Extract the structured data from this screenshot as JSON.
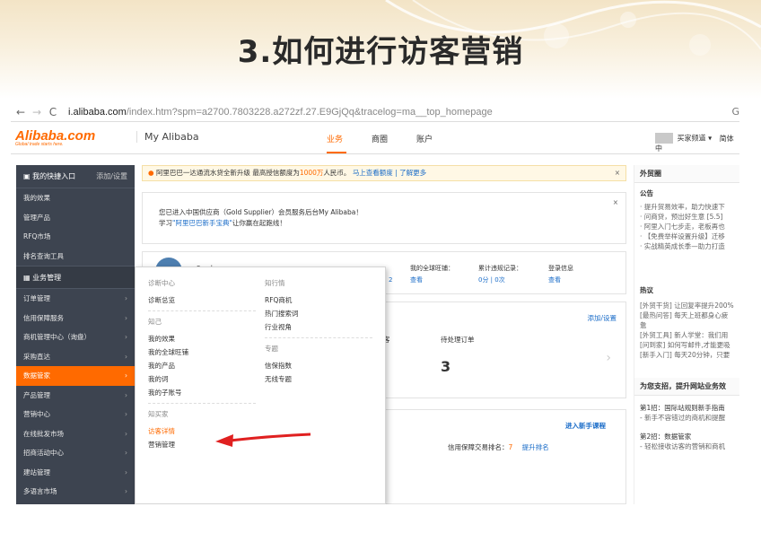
{
  "slide": {
    "title": "3.如何进行访客营销"
  },
  "browser": {
    "back": "←",
    "forward": "→",
    "reload": "C",
    "url_host": "i.alibaba.com",
    "url_path": "/index.htm?spm=a2700.7803228.a272zf.27.E9GjQq&tracelog=ma__top_homepage",
    "url_tail": "G"
  },
  "header": {
    "logo": "Alibaba.com",
    "logo_tag": "Global trade starts here.",
    "section": "My Alibaba",
    "tabs": [
      "业务",
      "商圈",
      "账户"
    ],
    "active_tab": "业务",
    "right_links": [
      "买家频道 ▾",
      "简体中"
    ]
  },
  "sidebar": {
    "quick_title": "我的快捷入口",
    "quick_action": "添加/设置",
    "quick_items": [
      "我的效果",
      "管理产品",
      "RFQ市场",
      "排名查询工具"
    ],
    "business_title": "业务管理",
    "items": [
      {
        "label": "订单管理",
        "arrow": "›"
      },
      {
        "label": "信用保障服务",
        "arrow": "›"
      },
      {
        "label": "商机管理中心（询盘）",
        "arrow": "›"
      },
      {
        "label": "采购直达",
        "arrow": "›"
      },
      {
        "label": "数据管家",
        "arrow": "›"
      },
      {
        "label": "产品管理",
        "arrow": "›"
      },
      {
        "label": "营销中心",
        "arrow": "›"
      },
      {
        "label": "在线批发市场",
        "arrow": "›"
      },
      {
        "label": "招商活动中心",
        "arrow": "›"
      },
      {
        "label": "建站管理",
        "arrow": "›"
      },
      {
        "label": "多语言市场",
        "arrow": "›"
      }
    ],
    "highlighted": "数据管家"
  },
  "notice": {
    "text_a": "阿里巴巴一达通流水贷全新升级 最高授信额度为",
    "amount": "1000万",
    "text_b": "人民币。",
    "link": "马上查看额度 | 了解更多",
    "close": "×"
  },
  "welcome": {
    "line1": "您已进入中国供应商（Gold Supplier）会员服务后台My Alibaba！",
    "line2_a": "学习",
    "line2_link": "\"阿里巴巴新手宝典\"",
    "line2_b": "让你赢在起跑线！",
    "close": "×"
  },
  "stats": {
    "name": "Sarah",
    "global_rank_label": "我的全球旺铺：",
    "global_rank_value": "查看",
    "violation_label": "累计违规记录：",
    "violation_value": "0分 | 0次",
    "login_label": "登录信息",
    "login_value": "查看",
    "partial_value": "2"
  },
  "orders": {
    "add_link": "添加/设置",
    "pending_label": "待处理订单",
    "pending_value": "3",
    "partial_label": "客"
  },
  "tasks": {
    "link": "进入新手课程",
    "credit_label": "信用保障交易排名：",
    "credit_value": "7",
    "credit_link": "提升排名"
  },
  "dropdown": {
    "col1_head": "诊断中心",
    "col1_items": [
      "诊断总览"
    ],
    "col1_head2": "知己",
    "col1_items2": [
      "我的效果",
      "我的全球旺铺",
      "我的产品",
      "我的词",
      "我的子账号"
    ],
    "col1_head3": "知买家",
    "col1_items3": [
      "访客详情",
      "营销管理"
    ],
    "col2_head": "知行情",
    "col2_items": [
      "RFQ商机",
      "热门搜索词",
      "行业视角"
    ],
    "col2_head2": "专题",
    "col2_items2": [
      "信保指数",
      "无线专题"
    ]
  },
  "right": {
    "title": "外贸圈",
    "notice_head": "公告",
    "notices": [
      "提升贸易效率，助力快速下",
      "问商贷，预出好生意 [5.5]",
      "阿里入门七步走，老板再也",
      "【免费举样设置升级】迁移",
      "实战精英成长季—助力打造"
    ],
    "hot_head": "热议",
    "hots": [
      "[外贸干货] 让回复率提升200%",
      "[最热问答] 每天上班都身心疲惫",
      "[外贸工具] 新人学堂：我们用",
      "[问到家] 如何写邮件,才能更吸",
      "[新手入门] 每天20分钟，只要"
    ],
    "tips_head": "为您支招，提升网站业务效",
    "tip1": "第1招：国际站规则新手指南",
    "tip1_sub": "- 新手不容错过的商机和提醒",
    "tip2": "第2招：数据管家",
    "tip2_sub": "- 轻松接收访客的营销和商机"
  },
  "colors": {
    "accent": "#ff6a00",
    "sidebar": "#3d4450",
    "link": "#1a6cc8",
    "arrow": "#e02020"
  }
}
